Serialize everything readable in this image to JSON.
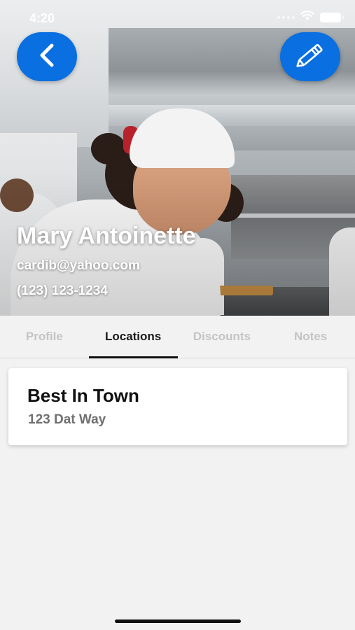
{
  "status_bar": {
    "time": "4:20",
    "icons": [
      "cellular-signal-icon",
      "wifi-icon",
      "battery-icon"
    ]
  },
  "header": {
    "back_icon": "chevron-left-icon",
    "edit_icon": "pencil-icon",
    "accent_color": "#0a6fe0"
  },
  "profile": {
    "name": "Mary Antoinette",
    "email": "cardib@yahoo.com",
    "phone": "(123) 123-1234"
  },
  "tabs": [
    {
      "label": "Profile",
      "active": false
    },
    {
      "label": "Locations",
      "active": true
    },
    {
      "label": "Discounts",
      "active": false
    },
    {
      "label": "Notes",
      "active": false
    }
  ],
  "locations": [
    {
      "name": "Best In Town",
      "address": "123 Dat Way"
    }
  ]
}
